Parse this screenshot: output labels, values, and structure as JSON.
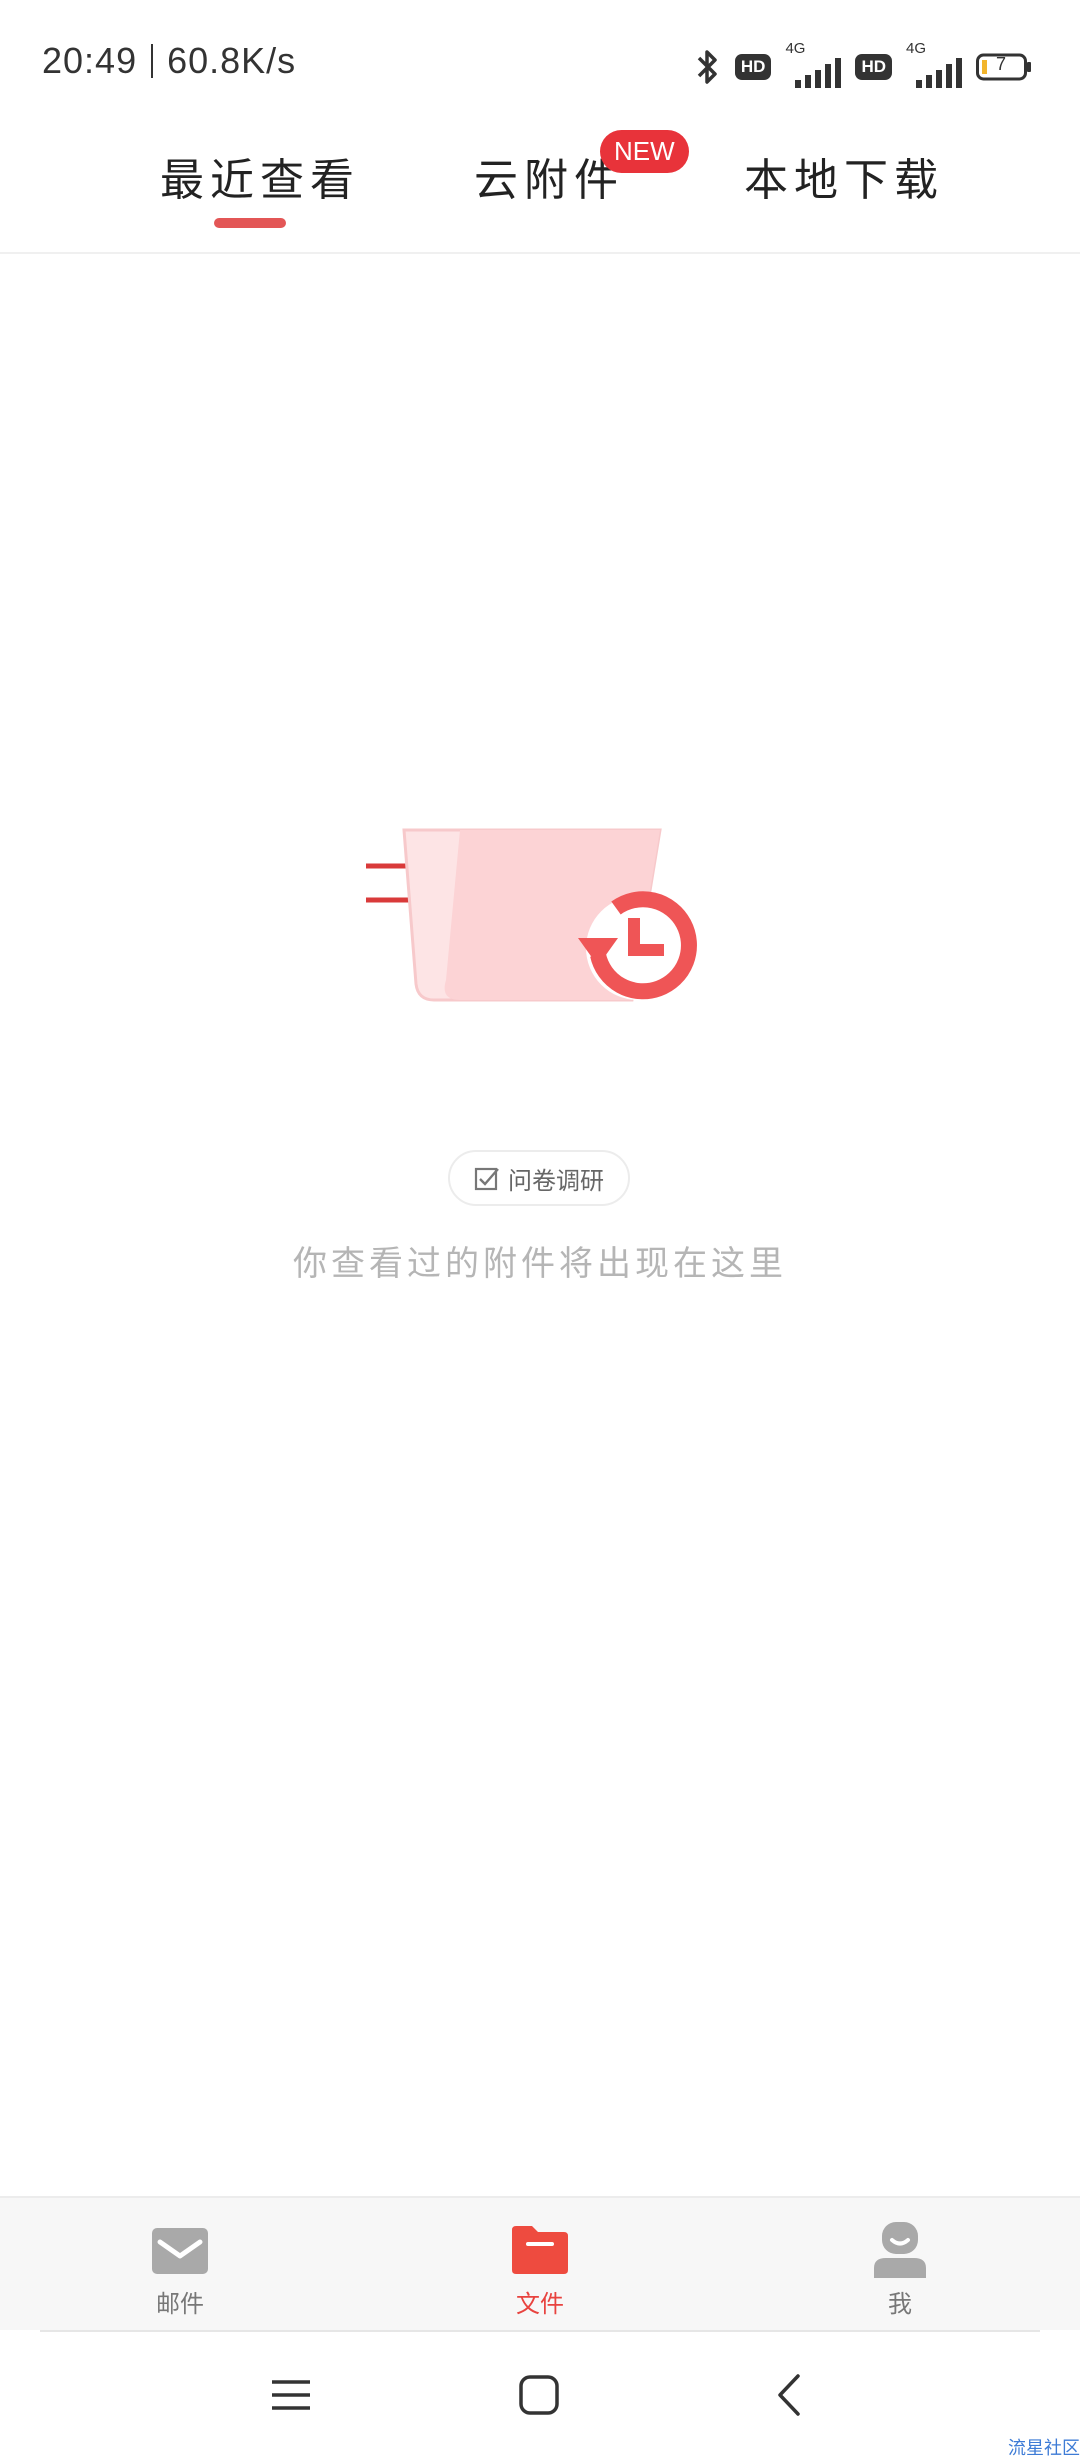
{
  "status_bar": {
    "time": "20:49",
    "net_speed": "60.8K/s",
    "hd_label": "HD",
    "network_type": "4G",
    "battery_level": "7"
  },
  "tabs": [
    {
      "label": "最近查看",
      "active": true
    },
    {
      "label": "云附件",
      "active": false
    },
    {
      "label": "本地下载",
      "active": false
    }
  ],
  "new_badge": "NEW",
  "empty_state": {
    "survey_label": "问卷调研",
    "message": "你查看过的附件将出现在这里"
  },
  "bottom_nav": [
    {
      "label": "邮件",
      "icon": "mail-icon",
      "active": false
    },
    {
      "label": "文件",
      "icon": "folder-icon",
      "active": true
    },
    {
      "label": "我",
      "icon": "person-icon",
      "active": false
    }
  ],
  "watermark": "流星社区",
  "colors": {
    "accent": "#e8433f",
    "accent_light": "#fcd3d5",
    "muted_text": "#b5b5b5"
  }
}
